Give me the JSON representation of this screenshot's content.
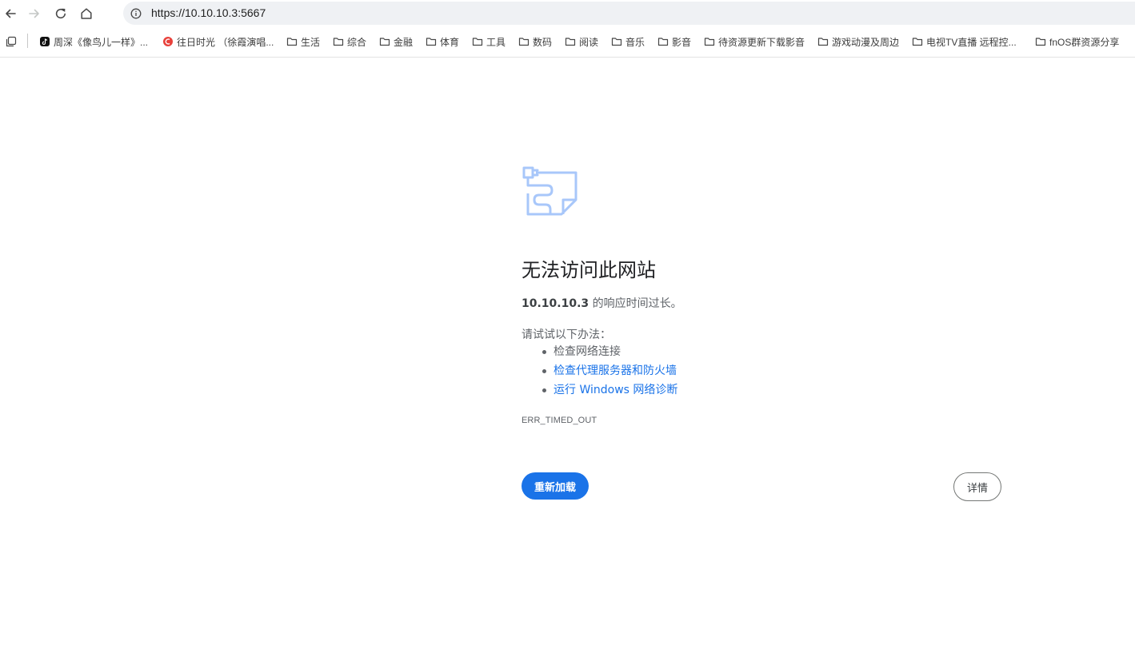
{
  "toolbar": {
    "url": "https://10.10.10.3:5667",
    "back_icon": "arrow-left-icon",
    "forward_icon": "arrow-right-icon",
    "reload_icon": "reload-icon",
    "home_icon": "home-icon",
    "site_info_icon": "info-circle-icon"
  },
  "bookmarks": {
    "items": [
      {
        "label": "周深《像鸟儿一样》...",
        "icon": "tiktok-icon"
      },
      {
        "label": "往日时光 （徐霞演唱...",
        "icon": "music-app-icon"
      },
      {
        "label": "生活",
        "icon": "folder-icon"
      },
      {
        "label": "综合",
        "icon": "folder-icon"
      },
      {
        "label": "金融",
        "icon": "folder-icon"
      },
      {
        "label": "体育",
        "icon": "folder-icon"
      },
      {
        "label": "工具",
        "icon": "folder-icon"
      },
      {
        "label": "数码",
        "icon": "folder-icon"
      },
      {
        "label": "阅读",
        "icon": "folder-icon"
      },
      {
        "label": "音乐",
        "icon": "folder-icon"
      },
      {
        "label": "影音",
        "icon": "folder-icon"
      },
      {
        "label": "待资源更新下载影音",
        "icon": "folder-icon"
      },
      {
        "label": "游戏动漫及周边",
        "icon": "folder-icon"
      },
      {
        "label": "电视TV直播 远程控...",
        "icon": "folder-icon"
      },
      {
        "label": "fnOS群资源分享",
        "icon": "folder-icon"
      }
    ]
  },
  "error": {
    "title": "无法访问此网站",
    "host": "10.10.10.3",
    "desc_suffix": " 的响应时间过长。",
    "try_label": "请试试以下办法：",
    "suggestions": [
      {
        "label": "检查网络连接"
      },
      {
        "label": "检查代理服务器和防火墙"
      },
      {
        "label": "运行 Windows 网络诊断"
      }
    ],
    "code": "ERR_TIMED_OUT",
    "reload_label": "重新加载",
    "details_label": "详情"
  },
  "colors": {
    "accent": "#1a73e8",
    "omnibox_bg": "#eff1f4",
    "icon_blue": "#a8c7fa"
  }
}
